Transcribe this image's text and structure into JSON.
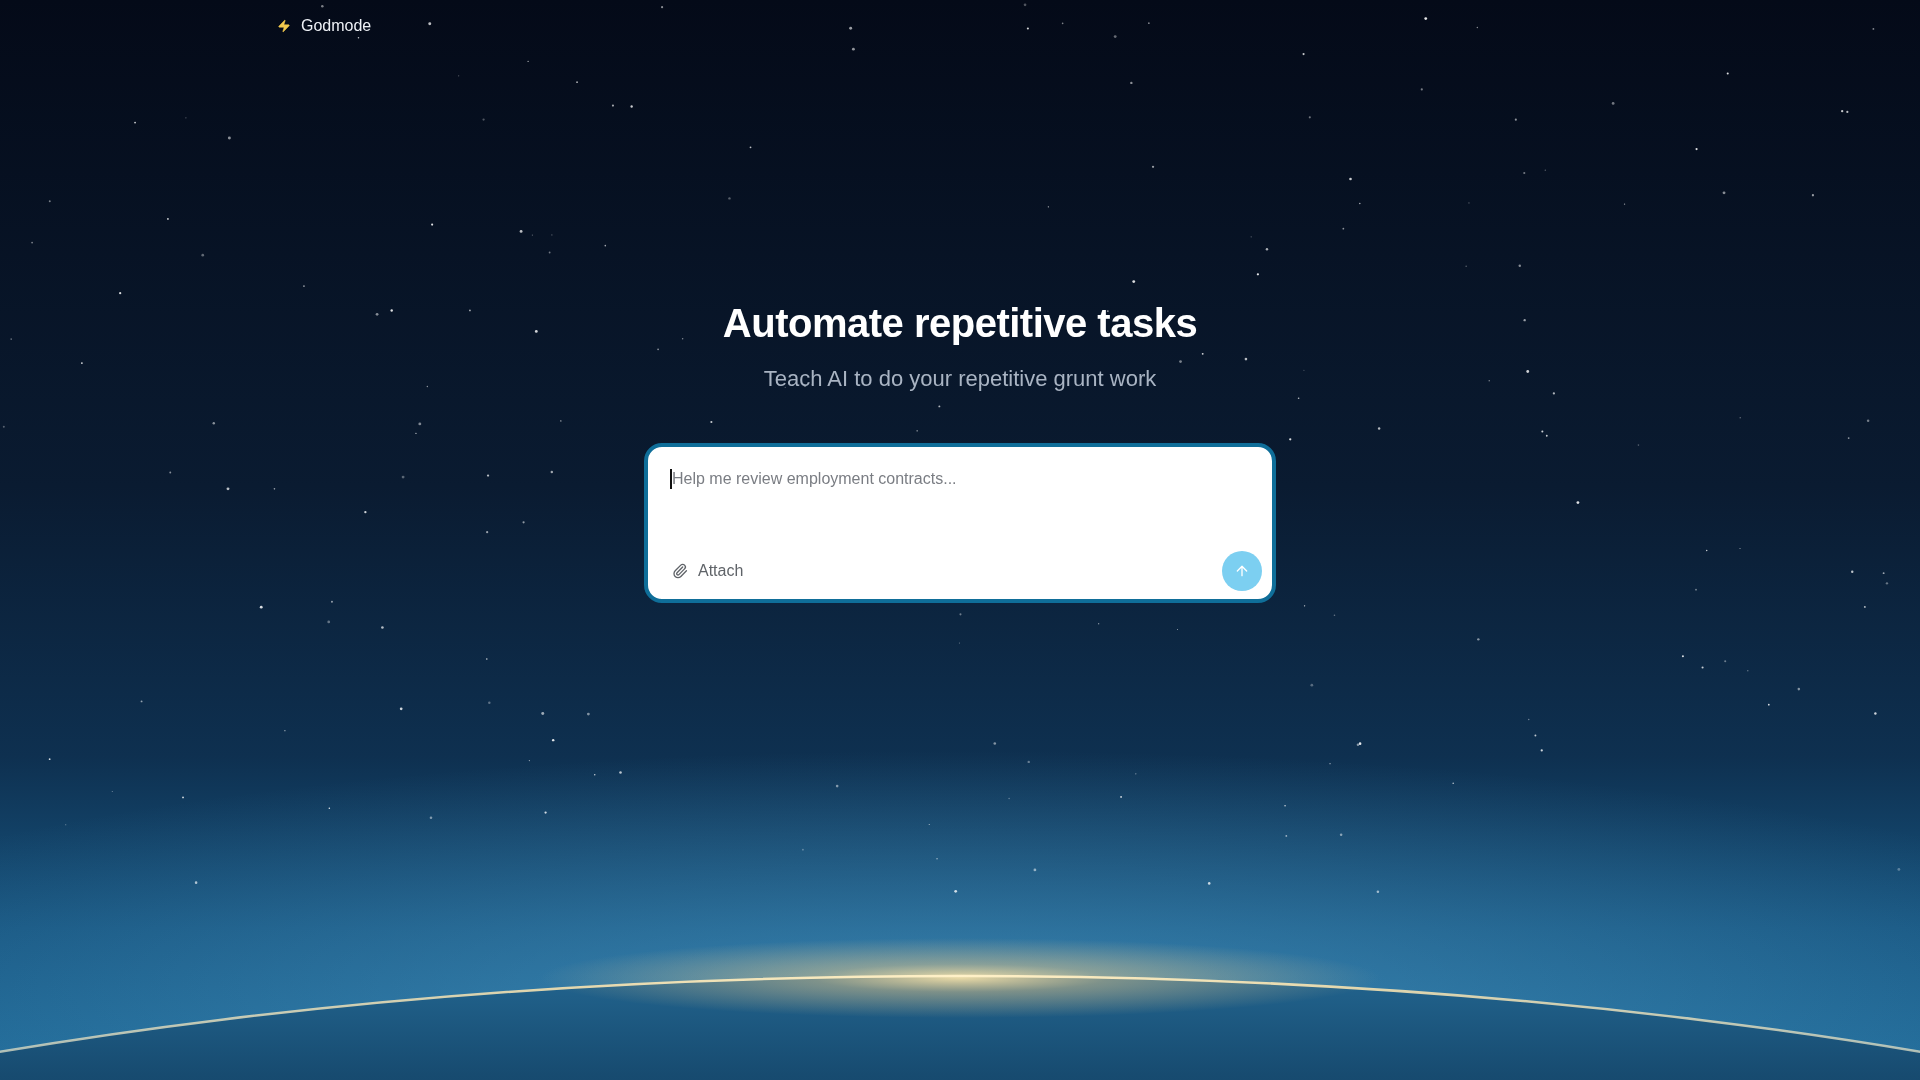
{
  "brand": {
    "name": "Godmode"
  },
  "hero": {
    "title": "Automate repetitive tasks",
    "subtitle": "Teach AI to do your repetitive grunt work"
  },
  "composer": {
    "placeholder": "Help me review employment contracts...",
    "focused": true,
    "attach": {
      "label": "Attach"
    },
    "send": {
      "disabled": true
    }
  }
}
